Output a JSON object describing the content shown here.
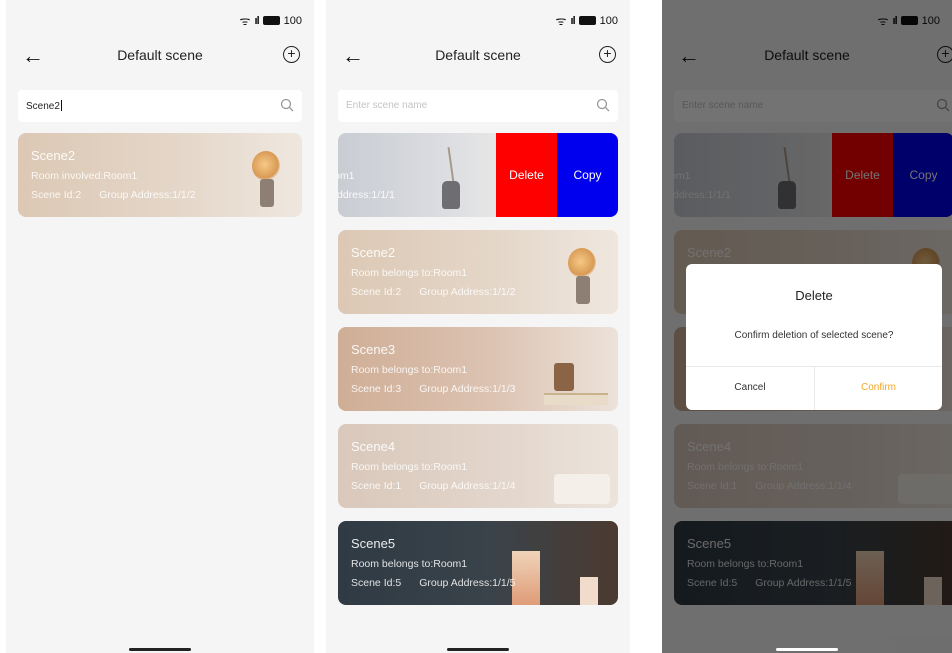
{
  "status": {
    "wifi": "ᯤ",
    "signal": "ıl",
    "battery": "100"
  },
  "header": {
    "title": "Default scene"
  },
  "screen1": {
    "search_value": "Scene2",
    "card": {
      "name": "Scene2",
      "room": "Room involved:Room1",
      "scene_id": "Scene Id:2",
      "group": "Group Address:1/1/2"
    }
  },
  "screen2": {
    "search_placeholder": "Enter scene name",
    "swiped": {
      "room": "om1",
      "group": "Address:1/1/1",
      "delete_label": "Delete",
      "copy_label": "Copy"
    },
    "cards": [
      {
        "name": "Scene2",
        "room": "Room belongs to:Room1",
        "scene_id": "Scene Id:2",
        "group": "Group Address:1/1/2"
      },
      {
        "name": "Scene3",
        "room": "Room belongs to:Room1",
        "scene_id": "Scene Id:3",
        "group": "Group Address:1/1/3"
      },
      {
        "name": "Scene4",
        "room": "Room belongs to:Room1",
        "scene_id": "Scene Id:1",
        "group": "Group Address:1/1/4"
      },
      {
        "name": "Scene5",
        "room": "Room belongs to:Room1",
        "scene_id": "Scene Id:5",
        "group": "Group Address:1/1/5"
      }
    ]
  },
  "dialog": {
    "title": "Delete",
    "message": "Confirm deletion of selected scene?",
    "cancel": "Cancel",
    "confirm": "Confirm",
    "confirm_color": "#f5a623"
  },
  "colors": {
    "delete": "#fe0000",
    "copy": "#0000ee"
  },
  "icons": [
    "back-arrow-icon",
    "add-circle-icon",
    "search-icon",
    "wifi-icon",
    "signal-icon",
    "battery-icon"
  ]
}
